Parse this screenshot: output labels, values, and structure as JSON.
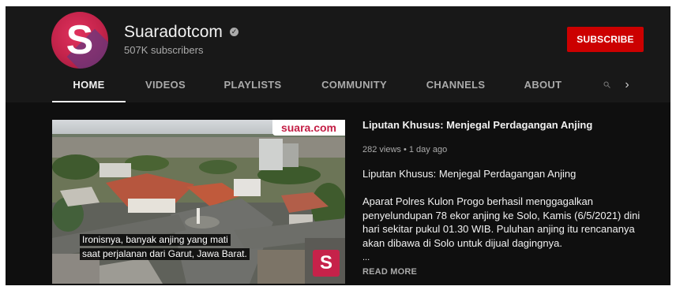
{
  "channel": {
    "avatar_letter": "S",
    "name": "Suaradotcom",
    "verified_icon": "verified-check-icon",
    "subscribers": "507K subscribers",
    "subscribe_label": "SUBSCRIBE"
  },
  "tabs": [
    {
      "label": "HOME",
      "active": true
    },
    {
      "label": "VIDEOS",
      "active": false
    },
    {
      "label": "PLAYLISTS",
      "active": false
    },
    {
      "label": "COMMUNITY",
      "active": false
    },
    {
      "label": "CHANNELS",
      "active": false
    },
    {
      "label": "ABOUT",
      "active": false
    }
  ],
  "tab_icons": {
    "search": "search-icon",
    "next": "chevron-right-icon"
  },
  "featured_video": {
    "title": "Liputan Khusus: Menjegal Perdagangan Anjing",
    "meta": "282 views • 1 day ago",
    "subtitle": "Liputan Khusus: Menjegal Perdagangan Anjing",
    "description_lines": [
      "Aparat Polres Kulon Progo berhasil menggagalkan",
      "penyelundupan 78 ekor anjing ke Solo, Kamis (6/5/2021) dini",
      "hari sekitar pukul 01.30 WIB. Puluhan anjing itu rencananya",
      "akan dibawa di Solo untuk dijual dagingnya."
    ],
    "ellipsis": "...",
    "read_more": "READ MORE",
    "thumbnail": {
      "badge": "suara.com",
      "caption_lines": [
        "Ironisnya, banyak anjing yang mati",
        "saat perjalanan dari Garut, Jawa Barat."
      ],
      "logo_letter": "S"
    }
  },
  "colors": {
    "header_bg": "#181818",
    "content_bg": "#0f0f0f",
    "subscribe_red": "#cc0000",
    "brand_magenta": "#c6224a"
  }
}
